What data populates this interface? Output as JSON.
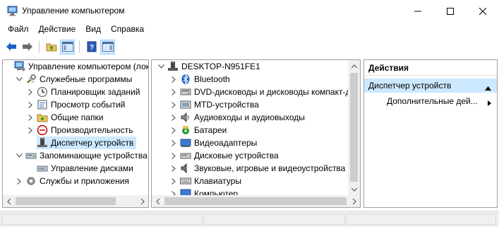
{
  "window": {
    "title": "Управление компьютером"
  },
  "menu": [
    "Файл",
    "Действие",
    "Вид",
    "Справка"
  ],
  "left_tree": {
    "items": [
      {
        "label": "Управление компьютером (лока",
        "icon": "computer-management-icon",
        "chevron": "",
        "indent": 0
      },
      {
        "label": "Служебные программы",
        "icon": "tools-icon",
        "chevron": "expanded",
        "indent": 1
      },
      {
        "label": "Планировщик заданий",
        "icon": "clock-icon",
        "chevron": "collapsed",
        "indent": 2
      },
      {
        "label": "Просмотр событий",
        "icon": "event-viewer-icon",
        "chevron": "collapsed",
        "indent": 2
      },
      {
        "label": "Общие папки",
        "icon": "shared-folder-icon",
        "chevron": "collapsed",
        "indent": 2
      },
      {
        "label": "Производительность",
        "icon": "performance-icon",
        "chevron": "collapsed",
        "indent": 2
      },
      {
        "label": "Диспетчер устройств",
        "icon": "device-manager-icon",
        "chevron": "",
        "indent": 2,
        "selected": true
      },
      {
        "label": "Запоминающие устройства",
        "icon": "storage-icon",
        "chevron": "expanded",
        "indent": 1
      },
      {
        "label": "Управление дисками",
        "icon": "disk-management-icon",
        "chevron": "",
        "indent": 2
      },
      {
        "label": "Службы и приложения",
        "icon": "services-icon",
        "chevron": "collapsed",
        "indent": 1
      }
    ]
  },
  "device_tree": {
    "root": "DESKTOP-N951FE1",
    "items": [
      {
        "label": "Bluetooth",
        "icon": "bluetooth-icon"
      },
      {
        "label": "DVD-дисководы и дисководы компакт-д",
        "icon": "dvd-drive-icon"
      },
      {
        "label": "MTD-устройства",
        "icon": "mtd-device-icon"
      },
      {
        "label": "Аудиовходы и аудиовыходы",
        "icon": "audio-io-icon"
      },
      {
        "label": "Батареи",
        "icon": "battery-icon"
      },
      {
        "label": "Видеоадаптеры",
        "icon": "display-adapter-icon"
      },
      {
        "label": "Дисковые устройства",
        "icon": "disk-drive-icon"
      },
      {
        "label": "Звуковые, игровые и видеоустройства",
        "icon": "sound-device-icon"
      },
      {
        "label": "Клавиатуры",
        "icon": "keyboard-icon"
      },
      {
        "label": "Компьютер",
        "icon": "computer-icon"
      }
    ]
  },
  "actions": {
    "header": "Действия",
    "section": "Диспетчер устройств",
    "more": "Дополнительные дей..."
  },
  "colors": {
    "selection": "#cce8ff",
    "toolbar_blue": "#1e62c8"
  }
}
